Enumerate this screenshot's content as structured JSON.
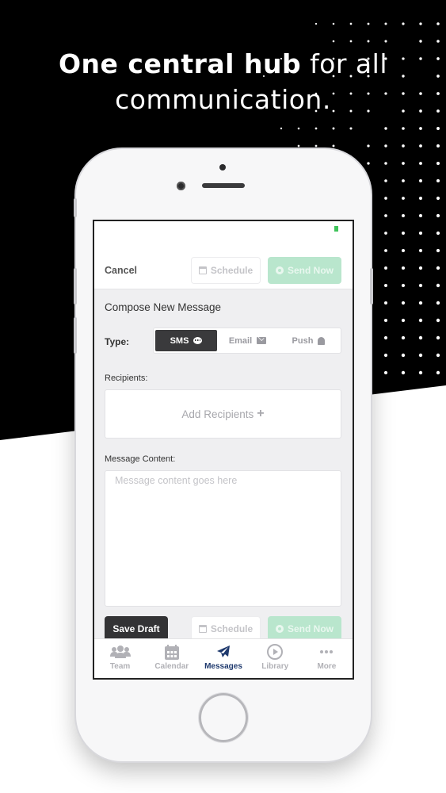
{
  "headline": {
    "bold": "One central hub",
    "rest_line1": " for all",
    "line2": "communication."
  },
  "nav": {
    "cancel": "Cancel",
    "schedule": "Schedule",
    "send_now": "Send Now"
  },
  "compose": {
    "title": "Compose New Message",
    "type_label": "Type:",
    "types": [
      {
        "label": "SMS",
        "icon": "chat-bubble-icon",
        "active": true
      },
      {
        "label": "Email",
        "icon": "envelope-icon",
        "active": false
      },
      {
        "label": "Push",
        "icon": "bell-icon",
        "active": false
      }
    ],
    "recipients_label": "Recipients:",
    "add_recipients": "Add Recipients",
    "content_label": "Message Content:",
    "content_placeholder": "Message content goes here"
  },
  "actions": {
    "save_draft": "Save Draft",
    "schedule": "Schedule",
    "send_now": "Send Now"
  },
  "tabs": [
    {
      "label": "Team",
      "icon": "team-icon",
      "active": false
    },
    {
      "label": "Calendar",
      "icon": "calendar-icon",
      "active": false
    },
    {
      "label": "Messages",
      "icon": "paper-plane-icon",
      "active": true
    },
    {
      "label": "Library",
      "icon": "play-circle-icon",
      "active": false
    },
    {
      "label": "More",
      "icon": "more-dots-icon",
      "active": false
    }
  ],
  "colors": {
    "background_dark": "#000000",
    "accent_green_disabled": "#b9e6cd",
    "active_tab": "#1f3a6e",
    "segment_active": "#3a3a3c",
    "battery": "#3ec35a"
  }
}
